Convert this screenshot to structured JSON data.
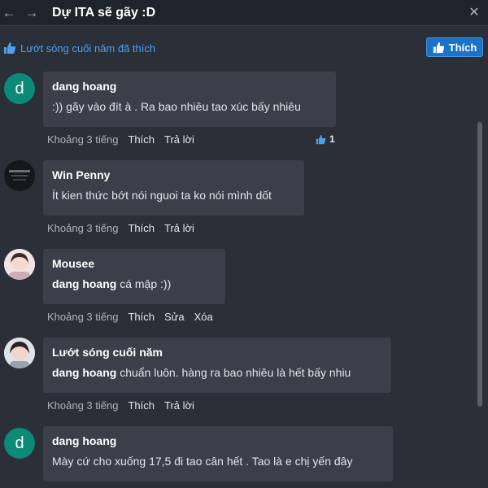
{
  "window": {
    "title": "Dự ITA sẽ gãy :D",
    "back_icon": "←",
    "forward_icon": "→",
    "close_icon": "✕"
  },
  "likebar": {
    "text": "Lướt sóng cuối năm đã thích",
    "like_button_label": "Thích"
  },
  "colors": {
    "accent": "#1a73c9",
    "link": "#4f9ff0",
    "bubble": "#3a3f4a",
    "background": "#2b2f38"
  },
  "comments": [
    {
      "author": "dang hoang",
      "avatar_letter": "d",
      "mention": "",
      "text": ":)) gãy vào đít à . Ra bao nhiêu tao xúc bấy nhiêu",
      "time": "Khoảng 3 tiếng",
      "actions": [
        "Thích",
        "Trả lời"
      ],
      "likes": "1"
    },
    {
      "author": "Win Penny",
      "avatar_letter": "",
      "mention": "",
      "text": "Ít kien thức bớt nói nguoi ta ko nói mình dốt",
      "time": "Khoảng 3 tiếng",
      "actions": [
        "Thích",
        "Trả lời"
      ],
      "likes": ""
    },
    {
      "author": "Mousee",
      "avatar_letter": "",
      "mention": "dang hoang",
      "text": "cá mập :))",
      "time": "Khoảng 3 tiếng",
      "actions": [
        "Thích",
        "Sửa",
        "Xóa"
      ],
      "likes": ""
    },
    {
      "author": "Lướt sóng cuối năm",
      "avatar_letter": "",
      "mention": "dang hoang",
      "text": "chuẩn luôn. hàng ra bao nhiêu là hết bấy nhiu",
      "time": "Khoảng 3 tiếng",
      "actions": [
        "Thích",
        "Trả lời"
      ],
      "likes": ""
    },
    {
      "author": "dang hoang",
      "avatar_letter": "d",
      "mention": "",
      "text": "Mày cứ cho xuống 17,5 đi tao cân hết . Tao là e chị yến đây",
      "time": "",
      "actions": [],
      "likes": ""
    }
  ]
}
